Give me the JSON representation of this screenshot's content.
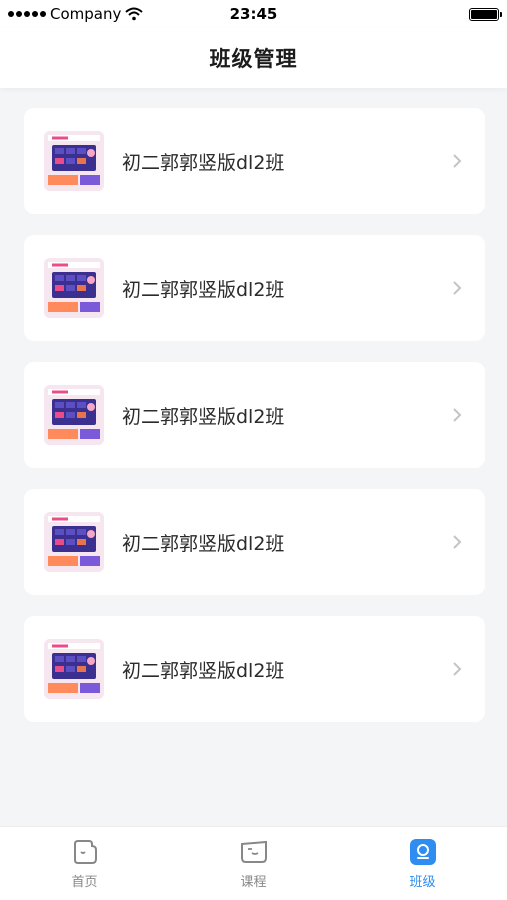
{
  "status_bar": {
    "carrier": "Company",
    "time": "23:45"
  },
  "header": {
    "title": "班级管理"
  },
  "classes": [
    {
      "name": "初二郭郭竖版dl2班"
    },
    {
      "name": "初二郭郭竖版dl2班"
    },
    {
      "name": "初二郭郭竖版dl2班"
    },
    {
      "name": "初二郭郭竖版dl2班"
    },
    {
      "name": "初二郭郭竖版dl2班"
    }
  ],
  "tabs": [
    {
      "label": "首页",
      "icon": "home-icon",
      "active": false
    },
    {
      "label": "课程",
      "icon": "course-icon",
      "active": false
    },
    {
      "label": "班级",
      "icon": "class-icon",
      "active": true
    }
  ],
  "colors": {
    "accent": "#2f8cf0",
    "background": "#f3f5f7",
    "card": "#ffffff",
    "inactive_tab": "#888888"
  }
}
